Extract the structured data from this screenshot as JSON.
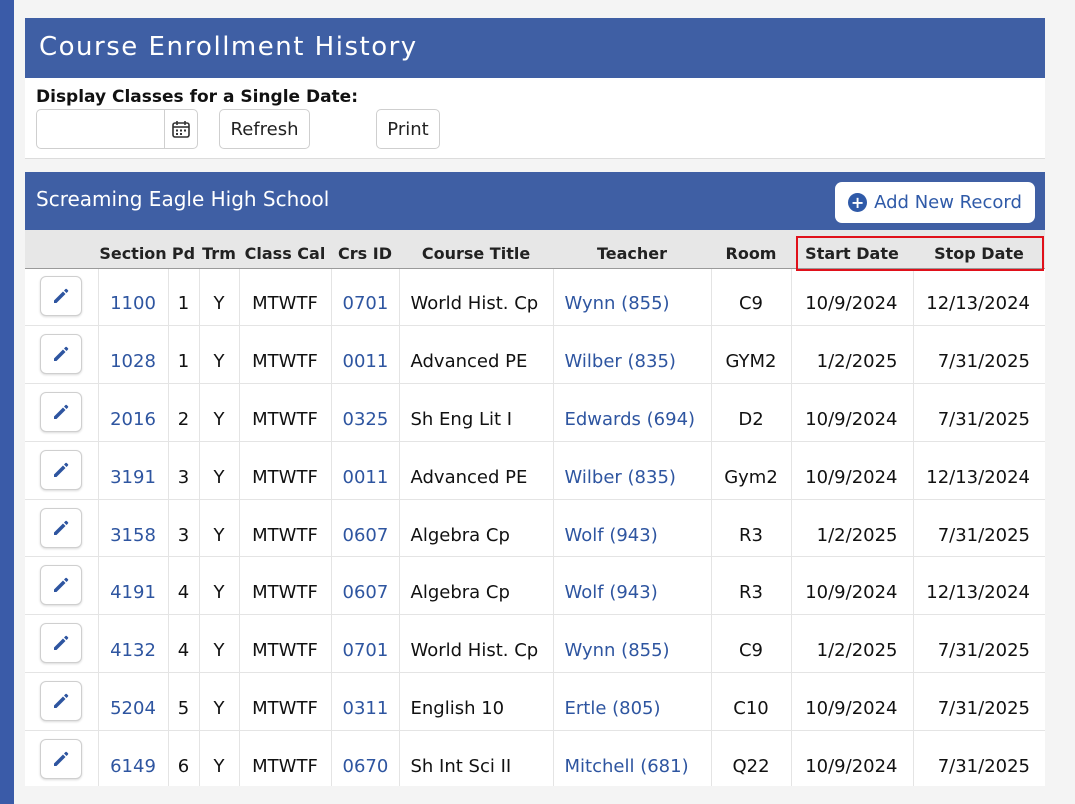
{
  "page": {
    "title": "Course Enrollment History"
  },
  "filter": {
    "label": "Display Classes for a Single Date:",
    "date_value": "",
    "refresh_label": "Refresh",
    "print_label": "Print"
  },
  "school": {
    "name": "Screaming Eagle High School",
    "add_label": "Add New Record"
  },
  "table": {
    "columns": [
      "",
      "Section",
      "Pd",
      "Trm",
      "Class Cal",
      "Crs ID",
      "Course Title",
      "Teacher",
      "Room",
      "Start Date",
      "Stop Date"
    ],
    "rows": [
      {
        "section": "1100",
        "pd": "1",
        "trm": "Y",
        "cal": "MTWTF",
        "crs": "0701",
        "title": "World Hist. Cp",
        "teacher": "Wynn (855)",
        "room": "C9",
        "start": "10/9/2024",
        "stop": "12/13/2024"
      },
      {
        "section": "1028",
        "pd": "1",
        "trm": "Y",
        "cal": "MTWTF",
        "crs": "0011",
        "title": "Advanced PE",
        "teacher": "Wilber (835)",
        "room": "GYM2",
        "start": "1/2/2025",
        "stop": "7/31/2025"
      },
      {
        "section": "2016",
        "pd": "2",
        "trm": "Y",
        "cal": "MTWTF",
        "crs": "0325",
        "title": "Sh Eng Lit I",
        "teacher": "Edwards (694)",
        "room": "D2",
        "start": "10/9/2024",
        "stop": "7/31/2025"
      },
      {
        "section": "3191",
        "pd": "3",
        "trm": "Y",
        "cal": "MTWTF",
        "crs": "0011",
        "title": "Advanced PE",
        "teacher": "Wilber (835)",
        "room": "Gym2",
        "start": "10/9/2024",
        "stop": "12/13/2024"
      },
      {
        "section": "3158",
        "pd": "3",
        "trm": "Y",
        "cal": "MTWTF",
        "crs": "0607",
        "title": "Algebra Cp",
        "teacher": "Wolf (943)",
        "room": "R3",
        "start": "1/2/2025",
        "stop": "7/31/2025"
      },
      {
        "section": "4191",
        "pd": "4",
        "trm": "Y",
        "cal": "MTWTF",
        "crs": "0607",
        "title": "Algebra Cp",
        "teacher": "Wolf (943)",
        "room": "R3",
        "start": "10/9/2024",
        "stop": "12/13/2024"
      },
      {
        "section": "4132",
        "pd": "4",
        "trm": "Y",
        "cal": "MTWTF",
        "crs": "0701",
        "title": "World Hist. Cp",
        "teacher": "Wynn (855)",
        "room": "C9",
        "start": "1/2/2025",
        "stop": "7/31/2025"
      },
      {
        "section": "5204",
        "pd": "5",
        "trm": "Y",
        "cal": "MTWTF",
        "crs": "0311",
        "title": "English 10",
        "teacher": "Ertle (805)",
        "room": "C10",
        "start": "10/9/2024",
        "stop": "7/31/2025"
      },
      {
        "section": "6149",
        "pd": "6",
        "trm": "Y",
        "cal": "MTWTF",
        "crs": "0670",
        "title": "Sh Int Sci II",
        "teacher": "Mitchell (681)",
        "room": "Q22",
        "start": "10/9/2024",
        "stop": "7/31/2025"
      }
    ]
  },
  "colors": {
    "header_blue": "#3f5fa4",
    "link_blue": "#2e55a0",
    "highlight_red": "#e0101a"
  },
  "icons": {
    "calendar": "calendar-icon",
    "plus": "plus-circle-icon",
    "edit": "pencil-icon"
  }
}
